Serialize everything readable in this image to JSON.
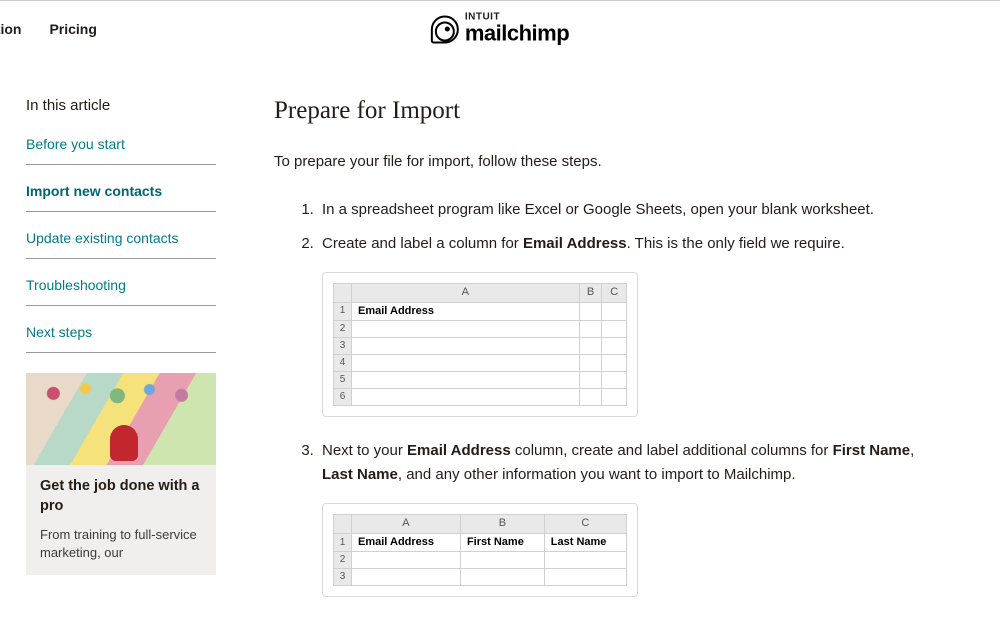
{
  "nav": {
    "item1": "ation",
    "item2": "Pricing"
  },
  "brand": {
    "intuit": "INTUIT",
    "name": "mailchimp"
  },
  "sidebar": {
    "heading": "In this article",
    "items": [
      {
        "label": "Before you start"
      },
      {
        "label": "Import new contacts"
      },
      {
        "label": "Update existing contacts"
      },
      {
        "label": "Troubleshooting"
      },
      {
        "label": "Next steps"
      }
    ],
    "promo": {
      "title": "Get the job done with a pro",
      "body": "From training to full-service marketing, our"
    }
  },
  "article": {
    "title": "Prepare for Import",
    "lead": "To prepare your file for import, follow these steps.",
    "step1": "In a spreadsheet program like Excel or Google Sheets, open your blank worksheet.",
    "step2_a": "Create and label a column for ",
    "step2_b": "Email Address",
    "step2_c": ". This is the only field we require.",
    "step3_a": "Next to your ",
    "step3_b": "Email Address",
    "step3_c": " column, create and label additional columns for ",
    "step3_d": "First Name",
    "step3_e": ", ",
    "step3_f": "Last Name",
    "step3_g": ", and any other information you want to import to Mailchimp."
  },
  "sheet1": {
    "cols": [
      "A",
      "B",
      "C"
    ],
    "rows": [
      "1",
      "2",
      "3",
      "4",
      "5",
      "6"
    ],
    "a1": "Email Address"
  },
  "sheet2": {
    "cols": [
      "A",
      "B",
      "C"
    ],
    "rows": [
      "1",
      "2",
      "3"
    ],
    "a1": "Email Address",
    "b1": "First Name",
    "c1": "Last Name"
  }
}
